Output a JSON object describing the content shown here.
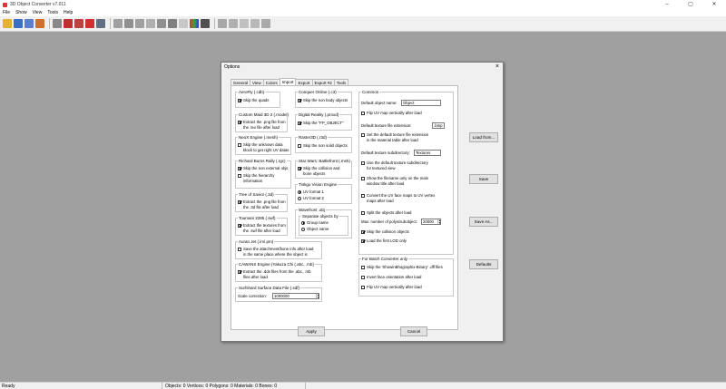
{
  "window": {
    "title": "3D Object Converter v7.011",
    "buttons": [
      "–",
      "▢",
      "✕"
    ]
  },
  "menu": [
    "File",
    "Show",
    "View",
    "Tools",
    "Help"
  ],
  "status": {
    "ready": "Ready",
    "stats": "Objects: 0   Vertices: 0   Polygons: 0   Materials: 0   Bones: 0"
  },
  "dialog": {
    "title": "Options",
    "close": "×",
    "tabs": [
      "General",
      "View",
      "Colors",
      "Import",
      "Export",
      "Export #2",
      "Tools"
    ],
    "active_tab": "Import",
    "groups": {
      "aerofly": {
        "label": "AeroFly (.cdb)",
        "opts": [
          {
            "text": "Skip the quads",
            "checked": true
          }
        ]
      },
      "custommaid": {
        "label": "Custom Maid 3D 2 (.model)",
        "opts": [
          {
            "text": "Extract the .png file from",
            "text2": "the .tex file after load",
            "checked": true
          }
        ]
      },
      "neox": {
        "label": "NeoX Engine (.mesh)",
        "opts": [
          {
            "text": "Skip the unknown data",
            "text2": "block to get right UV datas",
            "checked": false
          }
        ]
      },
      "richardburns": {
        "label": "Richard Burns Rally (.rgc)",
        "opts": [
          {
            "text": "Skip the non external objs",
            "checked": true
          },
          {
            "text": "Skip the hierarchy",
            "text2": "information",
            "checked": false
          }
        ]
      },
      "treeofsavior": {
        "label": "Tree of Savior (.3d)",
        "opts": [
          {
            "text": "Extract the .png file from",
            "text2": "the .3d file after load",
            "checked": true
          }
        ]
      },
      "toumani": {
        "label": "Toumani 2285 (.swf)",
        "opts": [
          {
            "text": "Extract the textures from",
            "text2": "the .swf file after load",
            "checked": true
          }
        ]
      },
      "aurasjet": {
        "label": "Auran Jet (.im/.pm)",
        "opts": [
          {
            "text": "Save the attachment/bone info after load",
            "text2": "in the same place where the object is",
            "checked": false
          }
        ]
      },
      "cawans": {
        "label": "CAWANS Engine (Yakuza Chi (.abc, .mb)",
        "opts": [
          {
            "text": "Extract the .dds files from the .abc, .mb",
            "text2": "files after load",
            "checked": true
          }
        ]
      },
      "surfshard": {
        "label": "Surfshard Surface Data File (.sdf)",
        "scale_label": "Scale correction:",
        "scale_value": "1000000"
      },
      "conquer": {
        "label": "Conquer Online (.c3)",
        "opts": [
          {
            "text": "Skip the non body objects",
            "checked": true
          }
        ]
      },
      "digital": {
        "label": "Digital Reality (.proxd)",
        "opts": [
          {
            "text": "Skip the \"FP_OBJECT\"",
            "checked": true
          }
        ]
      },
      "raster": {
        "label": "Raster3D (.r3d)",
        "opts": [
          {
            "text": "Skip the non solid objects",
            "checked": false
          }
        ]
      },
      "starwars": {
        "label": "Star Wars: Battlefront (.msh)",
        "opts": [
          {
            "text": "Skip the collision and",
            "text2": "bone objects",
            "checked": true
          }
        ]
      },
      "tinkgo": {
        "label": "Tinkgo Vision Engine",
        "radios": [
          {
            "text": "UV format 1",
            "checked": true
          },
          {
            "text": "UV format 2",
            "checked": false
          }
        ]
      },
      "wavefront": {
        "label": "Wavefront .obj",
        "sublabel": "Separate objects by",
        "radios": [
          {
            "text": "Group name",
            "checked": true
          },
          {
            "text": "Object name",
            "checked": false
          }
        ]
      },
      "common": {
        "label": "Common",
        "default_name_label": "Default object name:",
        "default_name_value": "Object",
        "flip_uv": {
          "text": "Flip UV map vertically after load",
          "checked": false
        },
        "tex_ext_label": "Default texture file extension:",
        "tex_ext_value": ".bmp",
        "set_ext": {
          "text": "Set the default texture file extension",
          "text2": "in the material table after load",
          "checked": false
        },
        "subdir_label": "Default texture subdirectory:",
        "subdir_value": "Textures",
        "use_subdir": {
          "text": "Use the default texture subdirectory",
          "text2": "for textured view",
          "checked": false
        },
        "show_filename": {
          "text": "Show the filename only on the main",
          "text2": "window title after load",
          "checked": false
        },
        "convert_uv": {
          "text": "Convert the UV face maps to UV vertex",
          "text2": "maps after load",
          "checked": false
        },
        "split": {
          "text": "Split the objects after load",
          "checked": false
        },
        "max_label": "Max. number of polys/subobject:",
        "max_value": "20000",
        "skip_collision": {
          "text": "Skip the collision objects",
          "checked": true
        },
        "load_lod": {
          "text": "Load the first LOD only",
          "checked": true
        }
      },
      "batch": {
        "label": "For Batch Converter only",
        "opts": [
          {
            "text": "Skip the 'ShowinBhographix-Binary' .dff files",
            "checked": false
          },
          {
            "text": "Invert face orientation after load",
            "checked": false
          },
          {
            "text": "Flip UV map vertically after load",
            "checked": false
          }
        ]
      }
    },
    "buttons": {
      "apply": "Apply",
      "cancel": "Cancel"
    },
    "side_buttons": {
      "load": "Load from...",
      "save": "Save",
      "saveas": "Save As...",
      "defaults": "Defaults"
    }
  }
}
